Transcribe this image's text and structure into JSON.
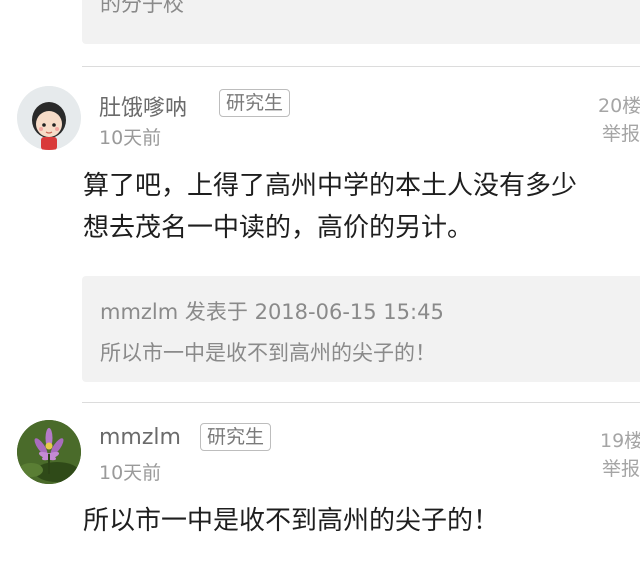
{
  "top_quote": {
    "text": "的分子校"
  },
  "posts": [
    {
      "username": "肚饿嗲呐",
      "badge": "研究生",
      "time": "10天前",
      "floor": "20楼",
      "report": "举报",
      "avatar_icon": "cartoon-girl-avatar-icon",
      "content_lines": [
        "算了吧，上得了高州中学的本土人没有多少",
        "想去茂名一中读的，高价的另计。"
      ],
      "quote": {
        "meta": "mmzlm 发表于 2018-06-15 15:45",
        "text": "所以市一中是收不到高州的尖子的！"
      }
    },
    {
      "username": "mmzlm",
      "badge": "研究生",
      "time": "10天前",
      "floor": "19楼",
      "report": "举报",
      "avatar_icon": "lotus-flower-avatar-icon",
      "content_lines": [
        "所以市一中是收不到高州的尖子的！"
      ]
    }
  ],
  "colors": {
    "background": "#ffffff",
    "quote_bg": "#f2f2f2",
    "divider": "#dcdcdc"
  }
}
